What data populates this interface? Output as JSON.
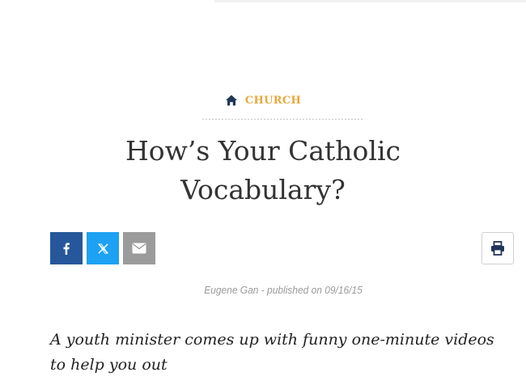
{
  "category": {
    "label": "CHURCH",
    "icon": "home-icon",
    "color": "#e6a93a",
    "icon_color": "#1f3658"
  },
  "article": {
    "title_line1": "How’s Your Catholic",
    "title_line2": "Vocabulary?",
    "author": "Eugene Gan",
    "published_prefix": " - published on ",
    "date": "09/16/15",
    "subtitle": "A youth minister comes up with funny one-minute videos to help you out"
  },
  "share": {
    "buttons": [
      {
        "name": "facebook",
        "icon": "facebook-icon",
        "color": "#26579a"
      },
      {
        "name": "x",
        "icon": "x-icon",
        "color": "#1da1f2"
      },
      {
        "name": "email",
        "icon": "envelope-icon",
        "color": "#9b9b9b"
      }
    ],
    "print_icon": "printer-icon"
  }
}
